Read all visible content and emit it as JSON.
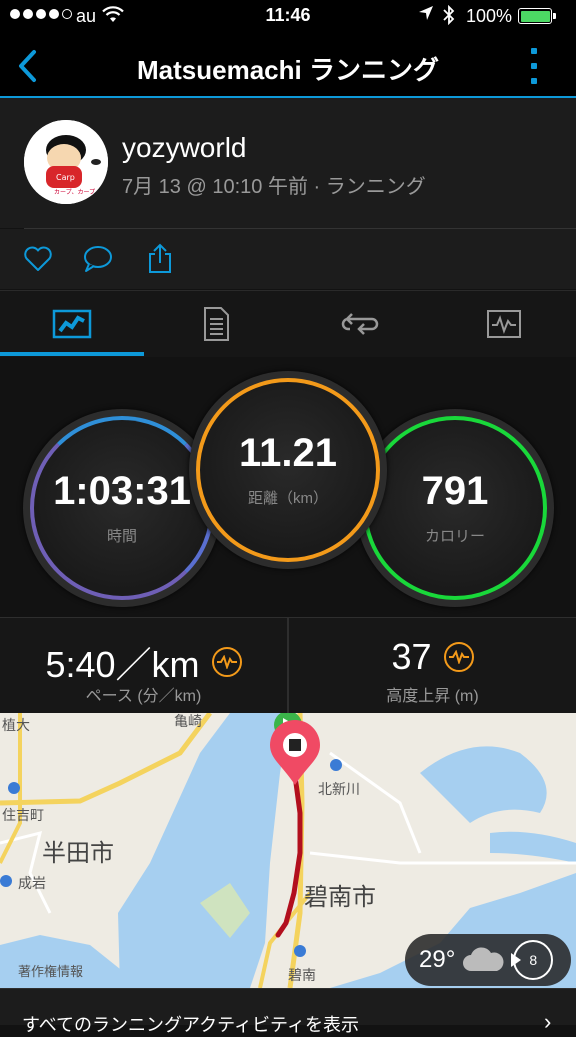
{
  "status_bar": {
    "carrier": "au",
    "time": "11:46",
    "battery": "100%",
    "signal_icon": "signal-dots-icon",
    "wifi_icon": "wifi-icon",
    "location_icon": "location-arrow-icon",
    "bluetooth_icon": "bluetooth-icon"
  },
  "nav": {
    "title": "Matsuemachi ランニング",
    "accent_color": "#0d99d9"
  },
  "profile": {
    "username": "yozyworld",
    "meta": "7月 13 @ 10:10 午前 · ランニング"
  },
  "actions": [
    "heart-icon",
    "comment-icon",
    "share-icon"
  ],
  "tabs": [
    "overview-icon",
    "details-icon",
    "laps-icon",
    "charts-icon"
  ],
  "stats": {
    "time": {
      "value": "1:03:31",
      "label": "時間",
      "color": "#6f5fb6"
    },
    "distance": {
      "value": "11.21",
      "label": "距離（km）",
      "color": "#f39a1a"
    },
    "calories": {
      "value": "791",
      "label": "カロリー",
      "color": "#19d83a"
    }
  },
  "metrics": {
    "pace": {
      "value": "5:40／km",
      "label": "ペース (分／km)"
    },
    "elevation": {
      "value": "37",
      "label": "高度上昇 (m)"
    }
  },
  "map": {
    "labels": {
      "uekdai": "植大",
      "kamesaki": "亀崎",
      "sumiyoshi": "住吉町",
      "handa": "半田市",
      "narusaki": "成岩",
      "kitashinkawa": "北新川",
      "hekinan_city": "碧南市",
      "hekinan": "碧南",
      "copyright": "著作権情報"
    }
  },
  "weather": {
    "temp": "29°",
    "wind_speed": "8",
    "icon": "cloud-icon"
  },
  "bottom": {
    "link": "すべてのランニングアクティビティを表示"
  }
}
